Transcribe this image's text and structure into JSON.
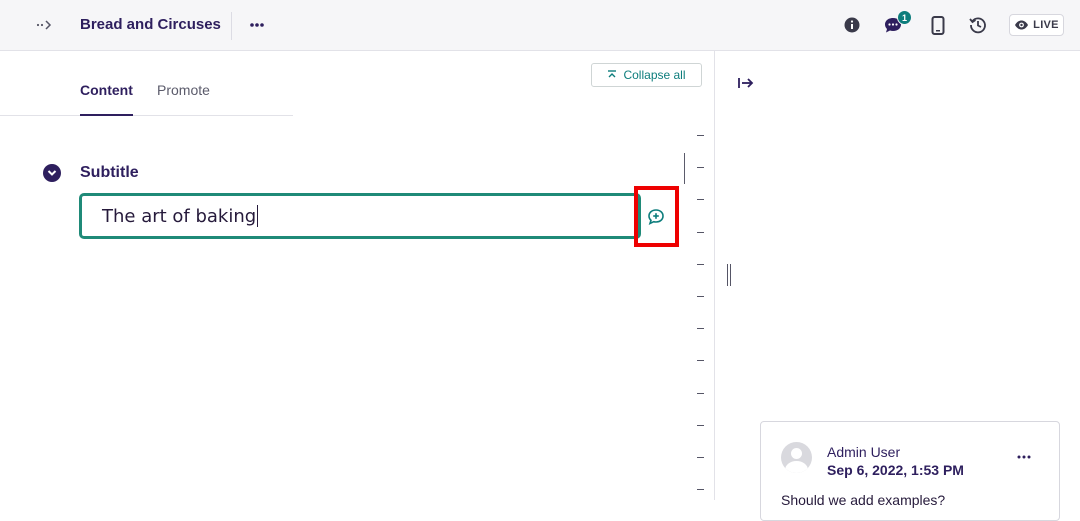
{
  "header": {
    "title": "Bread and Circuses",
    "comment_count": "1",
    "live_label": "LIVE",
    "icons": [
      "breadcrumb-toggle-icon",
      "more-actions-icon",
      "info-icon",
      "comments-icon",
      "preview-mobile-icon",
      "history-icon",
      "eye-icon"
    ]
  },
  "tabs": [
    {
      "label": "Content",
      "active": true
    },
    {
      "label": "Promote",
      "active": false
    }
  ],
  "toolbar": {
    "collapse_all_label": "Collapse all"
  },
  "field": {
    "label": "Subtitle",
    "value": "The art of baking"
  },
  "comment": {
    "author": "Admin User",
    "date": "Sep 6, 2022, 1:53 PM",
    "text": "Should we add examples?"
  },
  "colors": {
    "brand_purple": "#2e1f5e",
    "accent_teal": "#0d7d7c",
    "field_border": "#1f8a78",
    "highlight_red": "#ee0000"
  }
}
